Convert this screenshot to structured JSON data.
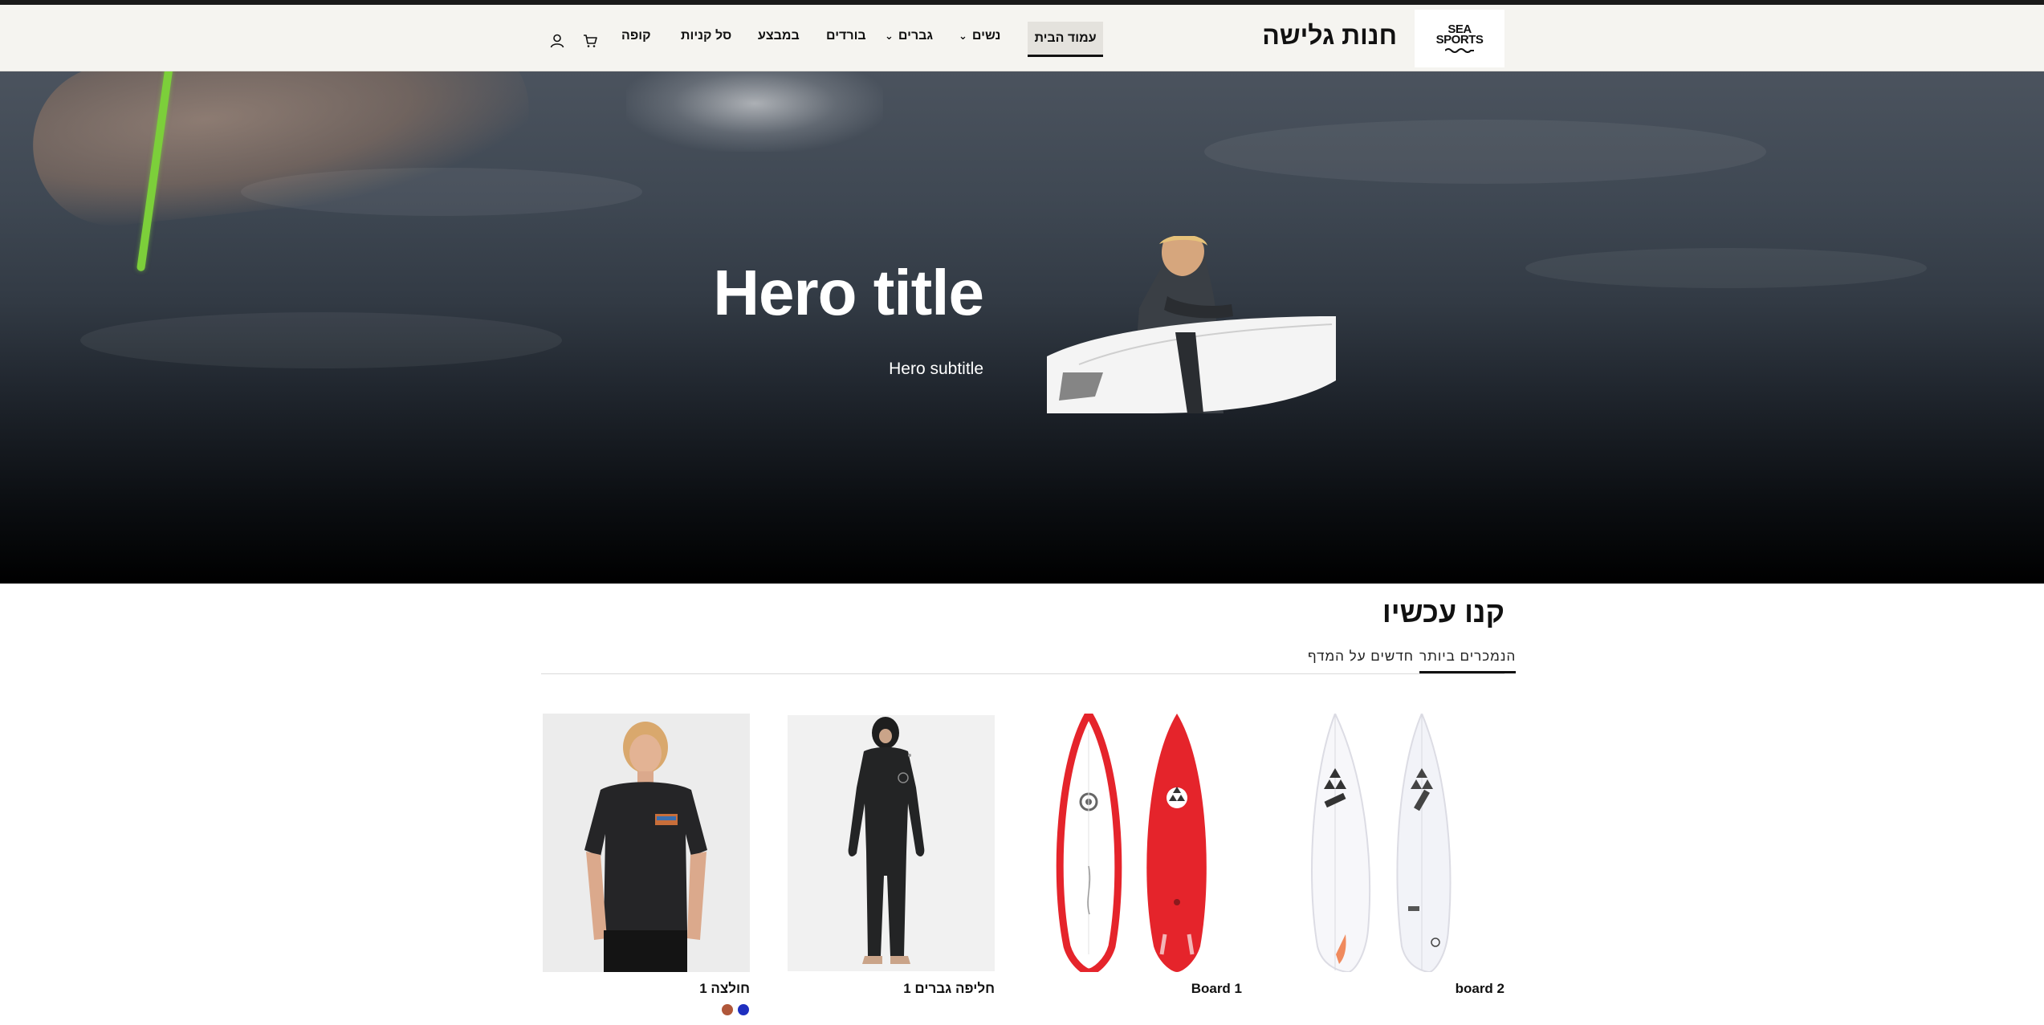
{
  "brand": {
    "logo_line1": "SEA",
    "logo_line2": "SPORTS",
    "store_name": "חנות גלישה"
  },
  "nav": {
    "home": "עמוד הבית",
    "women": "נשים",
    "men": "גברים",
    "boards": "בורדים",
    "sale": "במבצע",
    "cart_page": "סל קניות",
    "checkout": "קופה"
  },
  "icons": {
    "cart": "cart-icon",
    "account": "user-icon",
    "dropdown": "chevron-down-icon"
  },
  "hero": {
    "title": "Hero title",
    "subtitle": "Hero subtitle"
  },
  "shop": {
    "title": "קנו עכשיו",
    "tabs": [
      {
        "label": "הנמכרים ביותר",
        "active": true
      },
      {
        "label": "חדשים על המדף",
        "active": false
      }
    ],
    "products": [
      {
        "name": "board 2"
      },
      {
        "name": "Board 1"
      },
      {
        "name": "חליפה גברים 1"
      },
      {
        "name": "חולצה 1",
        "swatches": [
          "#1f2fbf",
          "#b0573a"
        ]
      }
    ]
  },
  "colors": {
    "header_bg": "#f5f4f0",
    "accent": "#111111",
    "board_red": "#e5242b"
  }
}
